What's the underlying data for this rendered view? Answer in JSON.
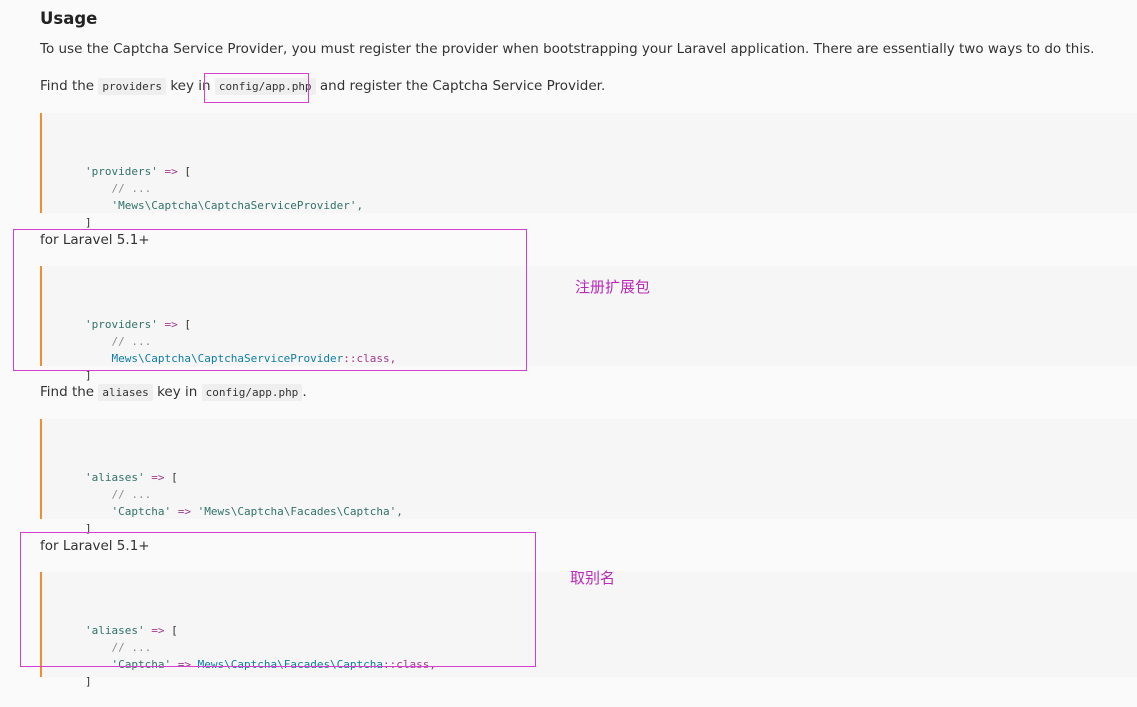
{
  "heading": "Usage",
  "intro": "To use the Captcha Service Provider, you must register the provider when bootstrapping your Laravel application. There are essentially two ways to do this.",
  "find_providers": {
    "prefix": "Find the",
    "key": "providers",
    "mid": "key in",
    "file": "config/app.php",
    "suffix": "and register the Captcha Service Provider."
  },
  "block1": {
    "line1_key": "'providers'",
    "line1_op": "=>",
    "line1_br": "[",
    "line2": "// ...",
    "line3": "'Mews\\Captcha\\CaptchaServiceProvider',",
    "line4": "]"
  },
  "laravel51_a": "for Laravel 5.1+",
  "block2": {
    "line1_key": "'providers'",
    "line1_op": "=>",
    "line1_br": "[",
    "line2": "// ...",
    "line3_cls": "Mews\\Captcha\\CaptchaServiceProvider",
    "line3_tail": "::class,",
    "line4": "]"
  },
  "annotation_register": "注册扩展包",
  "find_aliases": {
    "prefix": "Find the",
    "key": "aliases",
    "mid": "key in",
    "file": "config/app.php",
    "suffix": "."
  },
  "block3": {
    "line1_key": "'aliases'",
    "line1_op": "=>",
    "line1_br": "[",
    "line2": "// ...",
    "line3_key": "'Captcha'",
    "line3_op": "=>",
    "line3_val": "'Mews\\Captcha\\Facades\\Captcha',",
    "line4": "]"
  },
  "laravel51_b": "for Laravel 5.1+",
  "block4": {
    "line1_key": "'aliases'",
    "line1_op": "=>",
    "line1_br": "[",
    "line2": "// ...",
    "line3_key": "'Captcha'",
    "line3_op": "=>",
    "line3_cls": "Mews\\Captcha\\Facades\\Captcha",
    "line3_tail": "::class,",
    "line4": "]"
  },
  "annotation_alias": "取别名",
  "colors": {
    "accent_border": "#f08d2e",
    "annotation": "#b92bb9",
    "class_name": "#0f7ca5"
  }
}
